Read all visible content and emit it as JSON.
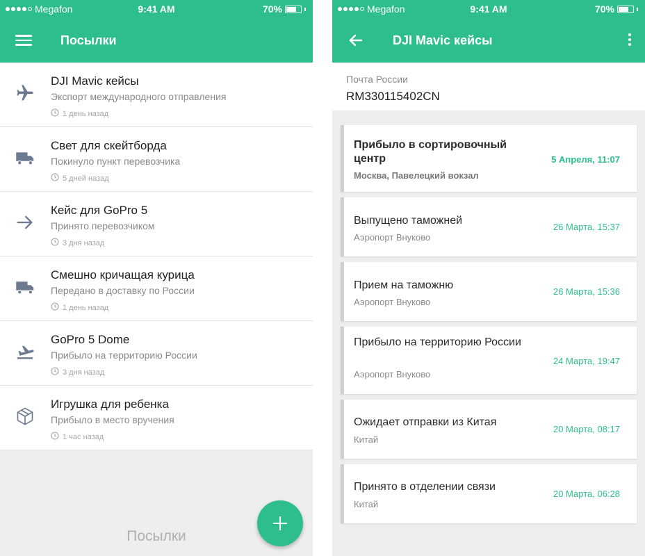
{
  "status_bar": {
    "carrier": "Megafon",
    "time": "9:41 AM",
    "battery": "70%",
    "battery_level": 0.7
  },
  "left_screen": {
    "title": "Посылки",
    "packages": [
      {
        "name": "DJI Mavic кейсы",
        "status": "Экспорт международного отправления",
        "time": "1 день назад",
        "icon": "airplane-icon"
      },
      {
        "name": "Свет для скейтборда",
        "status": "Покинуло пункт перевозчика",
        "time": "5 дней назад",
        "icon": "truck-icon"
      },
      {
        "name": "Кейс для GoPro 5",
        "status": "Принято перевозчиком",
        "time": "3 дня назад",
        "icon": "arrow-right-icon"
      },
      {
        "name": "Смешно кричащая курица",
        "status": "Передано в доставку по России",
        "time": "1 день назад",
        "icon": "truck-icon"
      },
      {
        "name": "GoPro 5 Dome",
        "status": "Прибыло на территорию России",
        "time": "3 дня назад",
        "icon": "landing-plane-icon"
      },
      {
        "name": "Игрушка для ребенка",
        "status": "Прибыло в место вручения",
        "time": "1 час назад",
        "icon": "box-icon"
      }
    ],
    "footer_label": "Посылки"
  },
  "right_screen": {
    "title": "DJI Mavic кейсы",
    "carrier": "Почта России",
    "tracking_number": "RM330115402CN",
    "events": [
      {
        "title": "Прибыло в сортировочный центр",
        "place": "Москва, Павелецкий вокзал",
        "date": "5 Апреля, 11:07"
      },
      {
        "title": "Выпущено таможней",
        "place": "Аэропорт Внуково",
        "date": "26 Марта, 15:37"
      },
      {
        "title": "Прием на таможню",
        "place": "Аэропорт Внуково",
        "date": "26 Марта, 15:36"
      },
      {
        "title": "Прибыло на территорию России",
        "place": "Аэропорт Внуково",
        "date": "24 Марта, 19:47"
      },
      {
        "title": "Ожидает отправки из Китая",
        "place": "Китай",
        "date": "20 Марта, 08:17"
      },
      {
        "title": "Принято в отделении связи",
        "place": "Китай",
        "date": "20 Марта, 06:28"
      }
    ]
  },
  "colors": {
    "accent": "#2dbe8c",
    "icon": "#6b7a90"
  }
}
